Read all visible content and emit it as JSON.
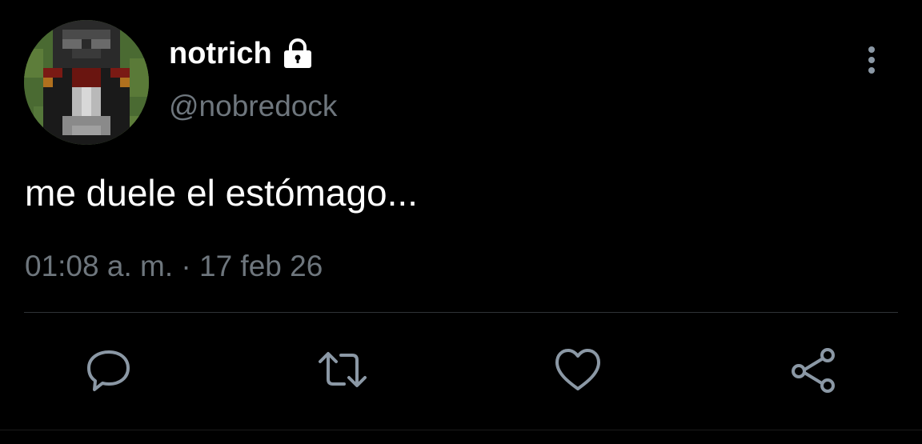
{
  "tweet": {
    "author": {
      "display_name": "notrich",
      "handle": "@nobredock",
      "avatar_icon": "pixel-character-avatar",
      "protected_icon": "lock-icon"
    },
    "text": "me duele el estómago...",
    "timestamp": "01:08 a. m. · 17 feb 26"
  },
  "actions": [
    {
      "name": "reply",
      "icon": "reply-icon"
    },
    {
      "name": "retweet",
      "icon": "retweet-icon"
    },
    {
      "name": "like",
      "icon": "heart-icon"
    },
    {
      "name": "share",
      "icon": "share-icon"
    }
  ],
  "colors": {
    "background": "#000000",
    "primary_text": "#ffffff",
    "secondary_text": "#6e767d",
    "icon": "#8b98a5",
    "divider": "#2f3336"
  }
}
